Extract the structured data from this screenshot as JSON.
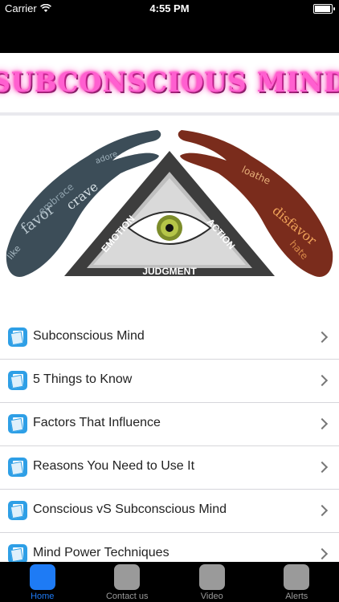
{
  "status_bar": {
    "carrier": "Carrier",
    "time": "4:55 PM"
  },
  "banner": {
    "title": "SUBCONSCIOUS MIND"
  },
  "hero": {
    "triangle_words": [
      "EMOTION",
      "ACTION",
      "JUDGMENT"
    ],
    "left_hand_words": [
      "favor",
      "crave",
      "embrace",
      "like",
      "adore"
    ],
    "right_hand_words": [
      "disfavor",
      "loathe",
      "hate"
    ]
  },
  "list": {
    "items": [
      {
        "label": "Subconscious Mind"
      },
      {
        "label": "5 Things to Know"
      },
      {
        "label": "Factors That Influence"
      },
      {
        "label": "Reasons You Need to Use It"
      },
      {
        "label": "Conscious vS Subconscious Mind"
      },
      {
        "label": "Mind Power Techniques"
      }
    ]
  },
  "tab_bar": {
    "tabs": [
      {
        "label": "Home",
        "active": true
      },
      {
        "label": "Contact us",
        "active": false
      },
      {
        "label": "Video",
        "active": false
      },
      {
        "label": "Alerts",
        "active": false
      }
    ]
  },
  "colors": {
    "accent": "#1e7bf5",
    "list_icon": "#2e9fe6",
    "logo_pink": "#ff5fd0"
  }
}
